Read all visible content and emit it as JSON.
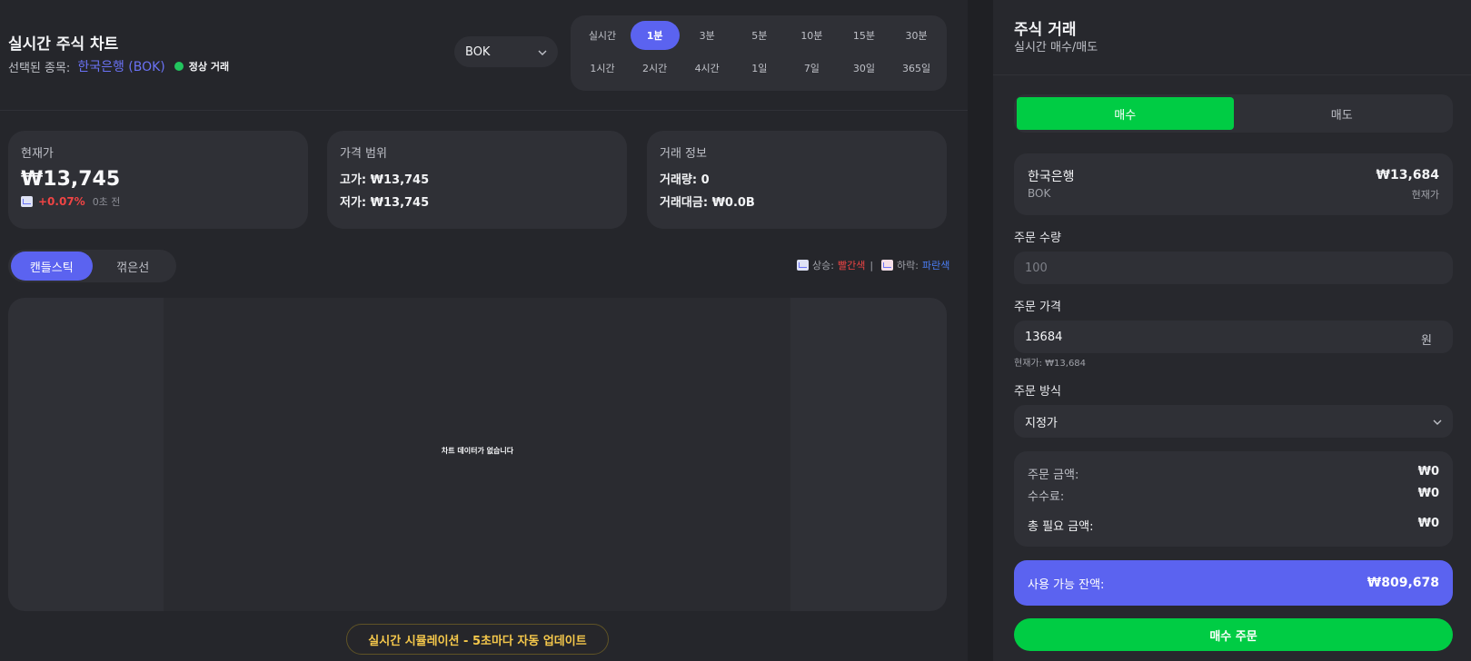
{
  "header": {
    "title": "실시간 주식 차트",
    "selected_label": "선택된 종목:",
    "selected_name": "한국은행 (BOK)",
    "status": "정상 거래"
  },
  "symbol_select": {
    "value": "BOK"
  },
  "timeframes": {
    "row1": [
      "실시간",
      "1분",
      "3분",
      "5분",
      "10분",
      "15분",
      "30분"
    ],
    "row2": [
      "1시간",
      "2시간",
      "4시간",
      "1일",
      "7일",
      "30일",
      "365일"
    ],
    "active": "1분"
  },
  "cards": {
    "current": {
      "label": "현재가",
      "price": "₩13,745",
      "change": "+0.07%",
      "time": "0초 전"
    },
    "range": {
      "label": "가격 범위",
      "high": "고가: ₩13,745",
      "low": "저가: ₩13,745"
    },
    "trade": {
      "label": "거래 정보",
      "volume": "거래량: 0",
      "amount": "거래대금: ₩0.0B"
    }
  },
  "chart_tabs": {
    "candlestick": "캔들스틱",
    "line": "꺾은선",
    "active": "candlestick"
  },
  "legend": {
    "up_label": "상승:",
    "up_color_name": "빨간색",
    "sep": "|",
    "down_label": "하락:",
    "down_color_name": "파란색"
  },
  "chart": {
    "empty_message": "차트 데이터가 없습니다"
  },
  "simulation_badge": "실시간 시뮬레이션 - 5초마다 자동 업데이트",
  "trade_panel": {
    "title": "주식 거래",
    "subtitle": "실시간 매수/매도",
    "buy_tab": "매수",
    "sell_tab": "매도",
    "active_side": "매수",
    "stock": {
      "name": "한국은행",
      "code": "BOK",
      "price": "₩13,684",
      "price_label": "현재가"
    },
    "quantity": {
      "label": "주문 수량",
      "value": "",
      "placeholder": "100"
    },
    "price": {
      "label": "주문 가격",
      "value": "13684",
      "suffix": "원",
      "hint": "현재가: ₩13,684"
    },
    "method": {
      "label": "주문 방식",
      "value": "지정가"
    },
    "summary": {
      "order_amount_label": "주문 금액:",
      "order_amount": "₩0",
      "fee_label": "수수료:",
      "fee": "₩0",
      "total_label": "총 필요 금액:",
      "total": "₩0"
    },
    "balance": {
      "label": "사용 가능 잔액:",
      "value": "₩809,678"
    },
    "submit": "매수 주문"
  },
  "colors": {
    "accent": "#5b63f0",
    "buy_green": "#00cc44",
    "up_red": "#ef4444",
    "down_blue": "#4a7df5",
    "status_green": "#22c55e",
    "warning_yellow": "#f5c84b"
  },
  "icons": {
    "dropdown": "chevron-down-icon",
    "trend": "chart-trend-icon"
  }
}
